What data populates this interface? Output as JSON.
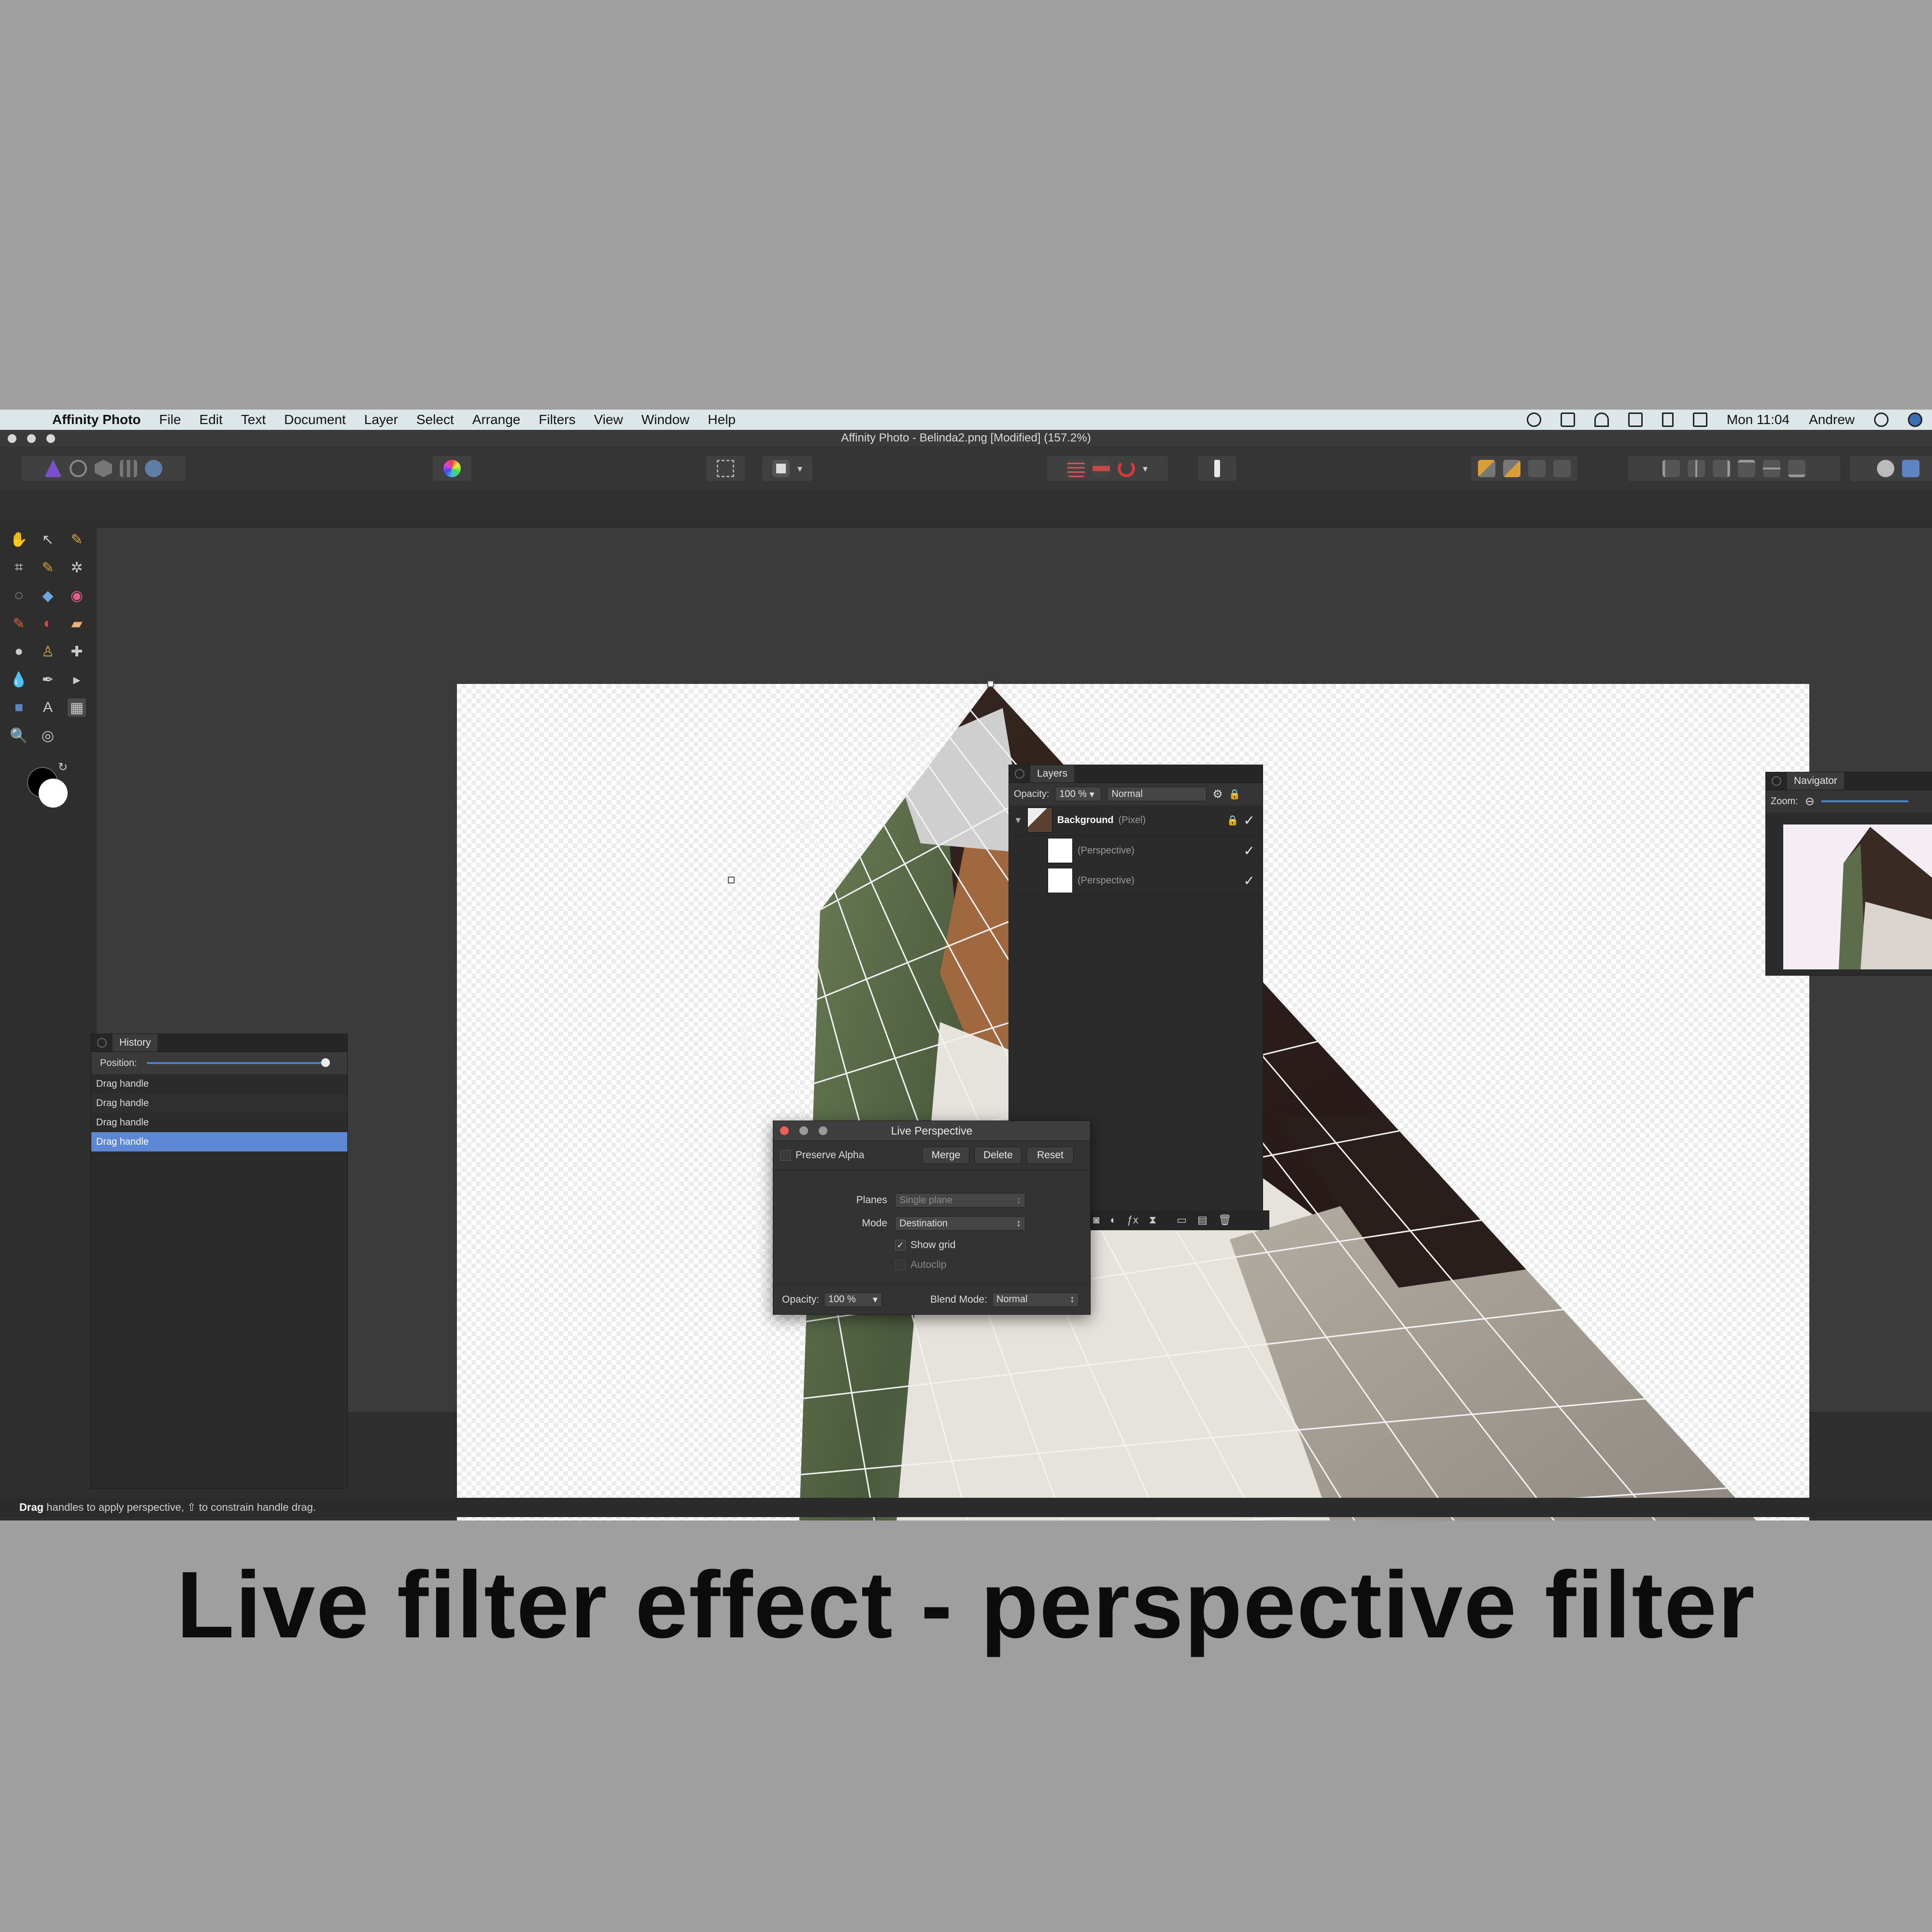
{
  "menubar": {
    "app_name": "Affinity Photo",
    "items": [
      "File",
      "Edit",
      "Text",
      "Document",
      "Layer",
      "Select",
      "Arrange",
      "Filters",
      "View",
      "Window",
      "Help"
    ],
    "clock": "Mon 11:04",
    "user": "Andrew"
  },
  "window": {
    "title": "Affinity Photo - Belinda2.png [Modified] (157.2%)"
  },
  "toolbar": {
    "persona_icons": [
      "photo-persona-icon",
      "liquify-persona-icon",
      "develop-persona-icon",
      "tone-mapping-persona-icon",
      "export-persona-icon"
    ],
    "colour_icon": "color-wheel-icon",
    "selection_icons": [
      "marquee-icon",
      "mask-icon"
    ],
    "snapping_icons": [
      "grid-icon",
      "assistant-icon",
      "snapping-magnet-icon"
    ],
    "order_icons": [
      "order-1-icon",
      "order-2-icon",
      "order-3-icon",
      "order-4-icon"
    ],
    "align_icons": [
      "align-left-icon",
      "align-center-icon",
      "align-right-icon",
      "align-top-icon",
      "align-middle-icon",
      "align-bottom-icon"
    ]
  },
  "history": {
    "tab": "History",
    "position_label": "Position:",
    "position_value": 1.0,
    "items": [
      "Drag handle",
      "Drag handle",
      "Drag handle",
      "Drag handle"
    ],
    "selected_index": 3
  },
  "layers": {
    "tab": "Layers",
    "opacity_label": "Opacity:",
    "opacity_value": "100 %",
    "blend_mode": "Normal",
    "rows": [
      {
        "name": "Background",
        "kind": "(Pixel)",
        "visible": "✓"
      },
      {
        "name": "",
        "kind": "(Perspective)",
        "visible": "✓"
      },
      {
        "name": "",
        "kind": "(Perspective)",
        "visible": "✓"
      }
    ]
  },
  "navigator": {
    "tab": "Navigator",
    "zoom_label": "Zoom:"
  },
  "live_perspective": {
    "title": "Live Perspective",
    "preserve_alpha_label": "Preserve Alpha",
    "merge_label": "Merge",
    "delete_label": "Delete",
    "reset_label": "Reset",
    "planes_label": "Planes",
    "planes_value": "Single plane",
    "mode_label": "Mode",
    "mode_value": "Destination",
    "show_grid_label": "Show grid",
    "show_grid_checked": "✓",
    "autoclip_label": "Autoclip",
    "opacity_label": "Opacity:",
    "opacity_value": "100 %",
    "blend_mode_label": "Blend Mode:",
    "blend_mode_value": "Normal"
  },
  "status": {
    "bold": "Drag",
    "text": " handles to apply perspective, ⇧ to constrain handle drag."
  },
  "caption": "Live filter effect - perspective filter",
  "colors": {
    "accent": "#5b87d3",
    "panel": "#2b2b2b",
    "menubar": "#dde6e9"
  }
}
